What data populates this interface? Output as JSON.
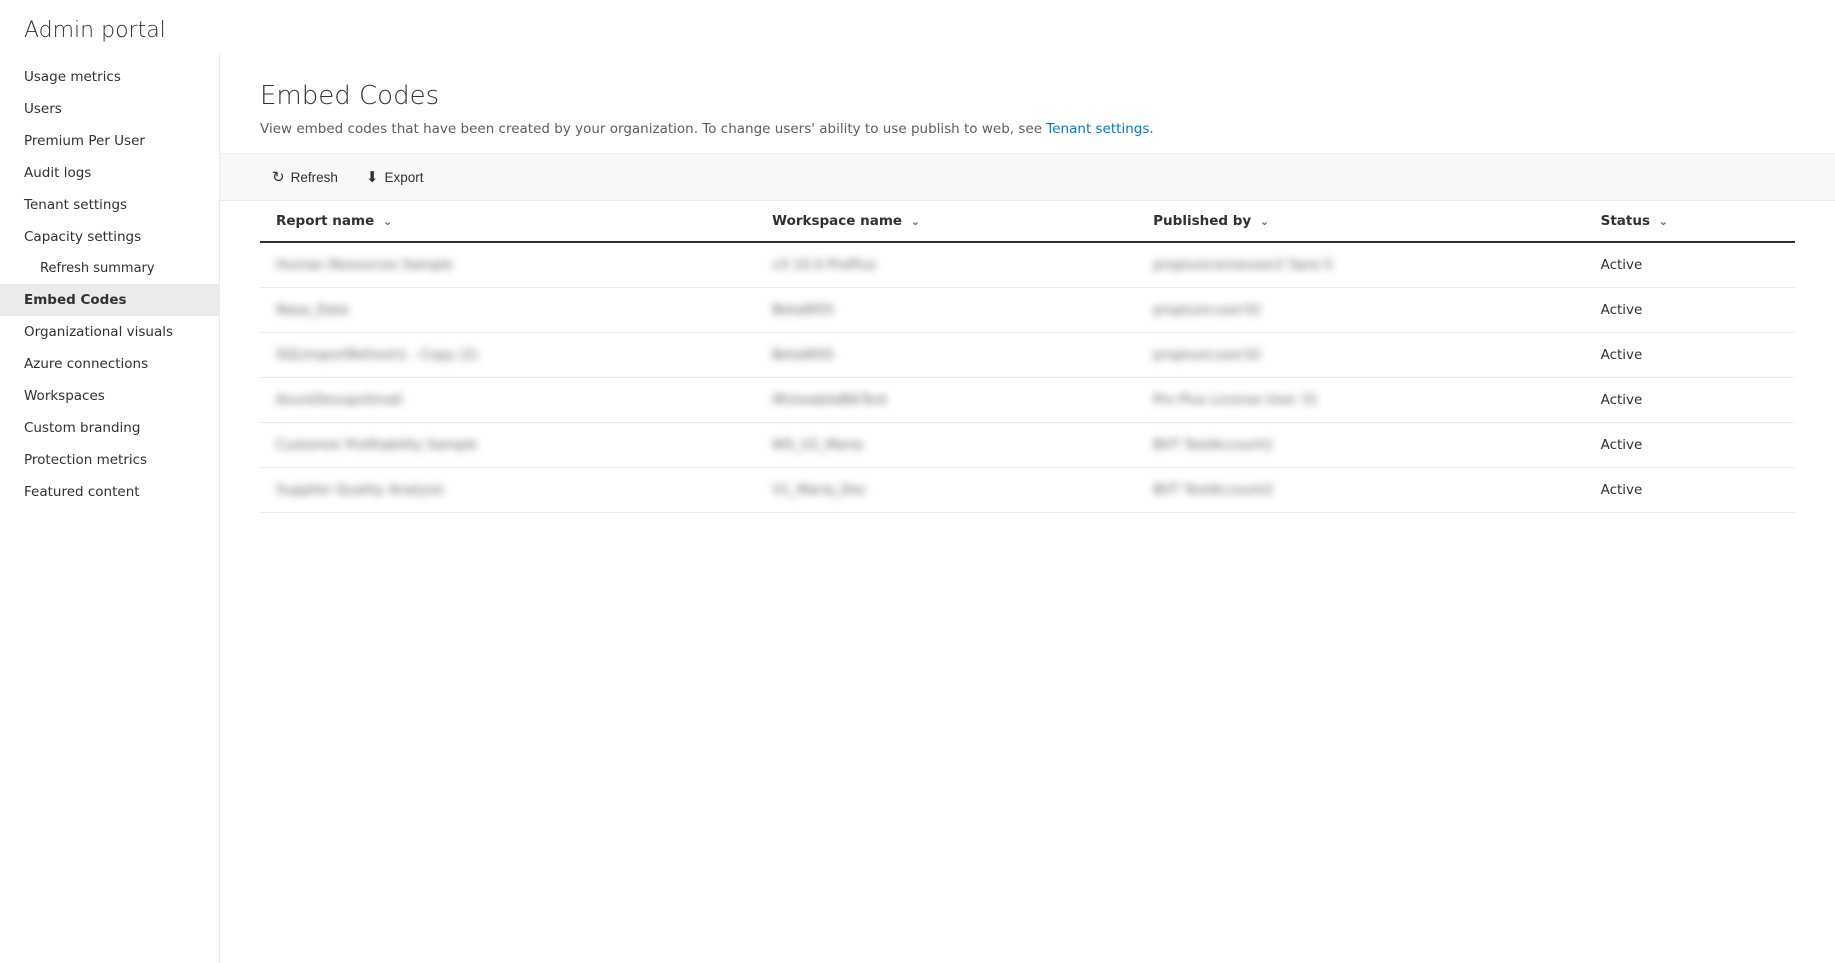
{
  "app": {
    "title": "Admin portal"
  },
  "sidebar": {
    "items": [
      {
        "id": "usage-metrics",
        "label": "Usage metrics",
        "active": false,
        "sub": false
      },
      {
        "id": "users",
        "label": "Users",
        "active": false,
        "sub": false
      },
      {
        "id": "premium-per-user",
        "label": "Premium Per User",
        "active": false,
        "sub": false
      },
      {
        "id": "audit-logs",
        "label": "Audit logs",
        "active": false,
        "sub": false
      },
      {
        "id": "tenant-settings",
        "label": "Tenant settings",
        "active": false,
        "sub": false
      },
      {
        "id": "capacity-settings",
        "label": "Capacity settings",
        "active": false,
        "sub": false
      },
      {
        "id": "refresh-summary",
        "label": "Refresh summary",
        "active": false,
        "sub": true
      },
      {
        "id": "embed-codes",
        "label": "Embed Codes",
        "active": true,
        "sub": false
      },
      {
        "id": "organizational-visuals",
        "label": "Organizational visuals",
        "active": false,
        "sub": false
      },
      {
        "id": "azure-connections",
        "label": "Azure connections",
        "active": false,
        "sub": false
      },
      {
        "id": "workspaces",
        "label": "Workspaces",
        "active": false,
        "sub": false
      },
      {
        "id": "custom-branding",
        "label": "Custom branding",
        "active": false,
        "sub": false
      },
      {
        "id": "protection-metrics",
        "label": "Protection metrics",
        "active": false,
        "sub": false
      },
      {
        "id": "featured-content",
        "label": "Featured content",
        "active": false,
        "sub": false
      }
    ]
  },
  "main": {
    "title": "Embed Codes",
    "description": "View embed codes that have been created by your organization. To change users' ability to use publish to web, see ",
    "description_link_text": "Tenant settings",
    "description_suffix": ".",
    "toolbar": {
      "refresh_label": "Refresh",
      "export_label": "Export"
    },
    "table": {
      "columns": [
        {
          "id": "report-name",
          "label": "Report name"
        },
        {
          "id": "workspace-name",
          "label": "Workspace name"
        },
        {
          "id": "published-by",
          "label": "Published by"
        },
        {
          "id": "status",
          "label": "Status"
        }
      ],
      "rows": [
        {
          "report_name": "Human Resources Sample",
          "workspace_name": "v3 10.0 ProPlus",
          "published_by": "proplusicenseuser2 Sara S",
          "status": "Active",
          "blurred": true
        },
        {
          "report_name": "Nasa_Data",
          "workspace_name": "BetaWS5",
          "published_by": "proplusicuser32",
          "status": "Active",
          "blurred": true
        },
        {
          "report_name": "SQLImportRefresh1 - Copy (2)",
          "workspace_name": "BetaWS5",
          "published_by": "proplusicuser32",
          "status": "Active",
          "blurred": true
        },
        {
          "report_name": "AzureDevopsSmall",
          "workspace_name": "IRUseableBIkTest",
          "published_by": "Pro Plus License User 31",
          "status": "Active",
          "blurred": true
        },
        {
          "report_name": "Customer Profitability Sample",
          "workspace_name": "WS_V2_Maria",
          "published_by": "BVT TestAccount1",
          "status": "Active",
          "blurred": true
        },
        {
          "report_name": "Supplier Quality Analysis",
          "workspace_name": "V1_Maria_Dec",
          "published_by": "BVT TestAccount2",
          "status": "Active",
          "blurred": true
        }
      ]
    }
  }
}
